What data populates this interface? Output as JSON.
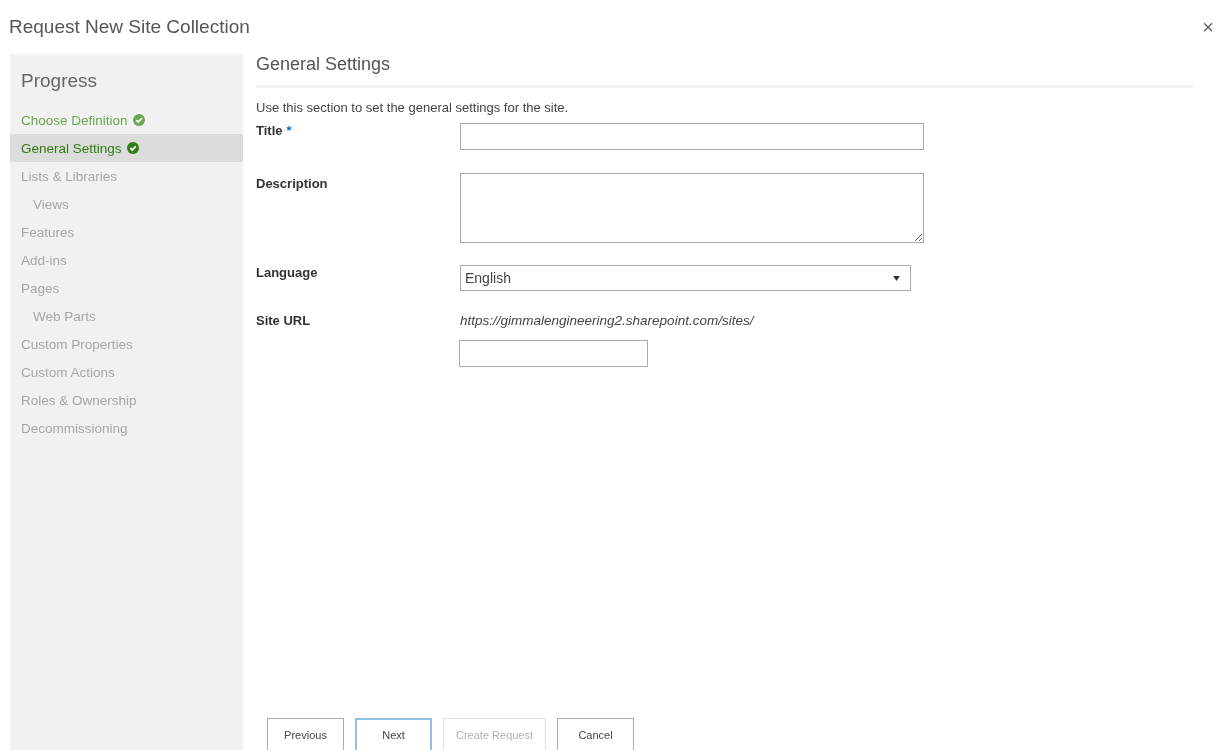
{
  "dialog": {
    "title": "Request New Site Collection",
    "close": "×"
  },
  "progress": {
    "heading": "Progress",
    "steps": [
      {
        "label": "Choose Definition",
        "completed": true,
        "selected": false
      },
      {
        "label": "General Settings",
        "completed": true,
        "selected": true
      },
      {
        "label": "Lists & Libraries",
        "completed": false,
        "selected": false,
        "children": [
          {
            "label": "Views",
            "completed": false,
            "selected": false
          }
        ]
      },
      {
        "label": "Features",
        "completed": false,
        "selected": false
      },
      {
        "label": "Add-ins",
        "completed": false,
        "selected": false
      },
      {
        "label": "Pages",
        "completed": false,
        "selected": false,
        "children": [
          {
            "label": "Web Parts",
            "completed": false,
            "selected": false
          }
        ]
      },
      {
        "label": "Custom Properties",
        "completed": false,
        "selected": false
      },
      {
        "label": "Custom Actions",
        "completed": false,
        "selected": false
      },
      {
        "label": "Roles & Ownership",
        "completed": false,
        "selected": false
      },
      {
        "label": "Decommissioning",
        "completed": false,
        "selected": false
      }
    ]
  },
  "section": {
    "heading": "General Settings",
    "intro": "Use this section to set the general settings for the site.",
    "fields": [
      {
        "kind": "text",
        "label": "Title",
        "required_mark": "*"
      },
      {
        "kind": "textarea",
        "label": "Description"
      },
      {
        "kind": "select",
        "label": "Language",
        "value": "English"
      },
      {
        "kind": "url",
        "label": "Site URL",
        "prefix": "https://gimmalengineering2.sharepoint.com/sites/"
      }
    ]
  },
  "buttons": [
    {
      "label": "Previous",
      "focused": false,
      "disabled": false
    },
    {
      "label": "Next",
      "focused": true,
      "disabled": false
    },
    {
      "label": "Create Request",
      "focused": false,
      "disabled": true
    },
    {
      "label": "Cancel",
      "focused": false,
      "disabled": false
    }
  ]
}
